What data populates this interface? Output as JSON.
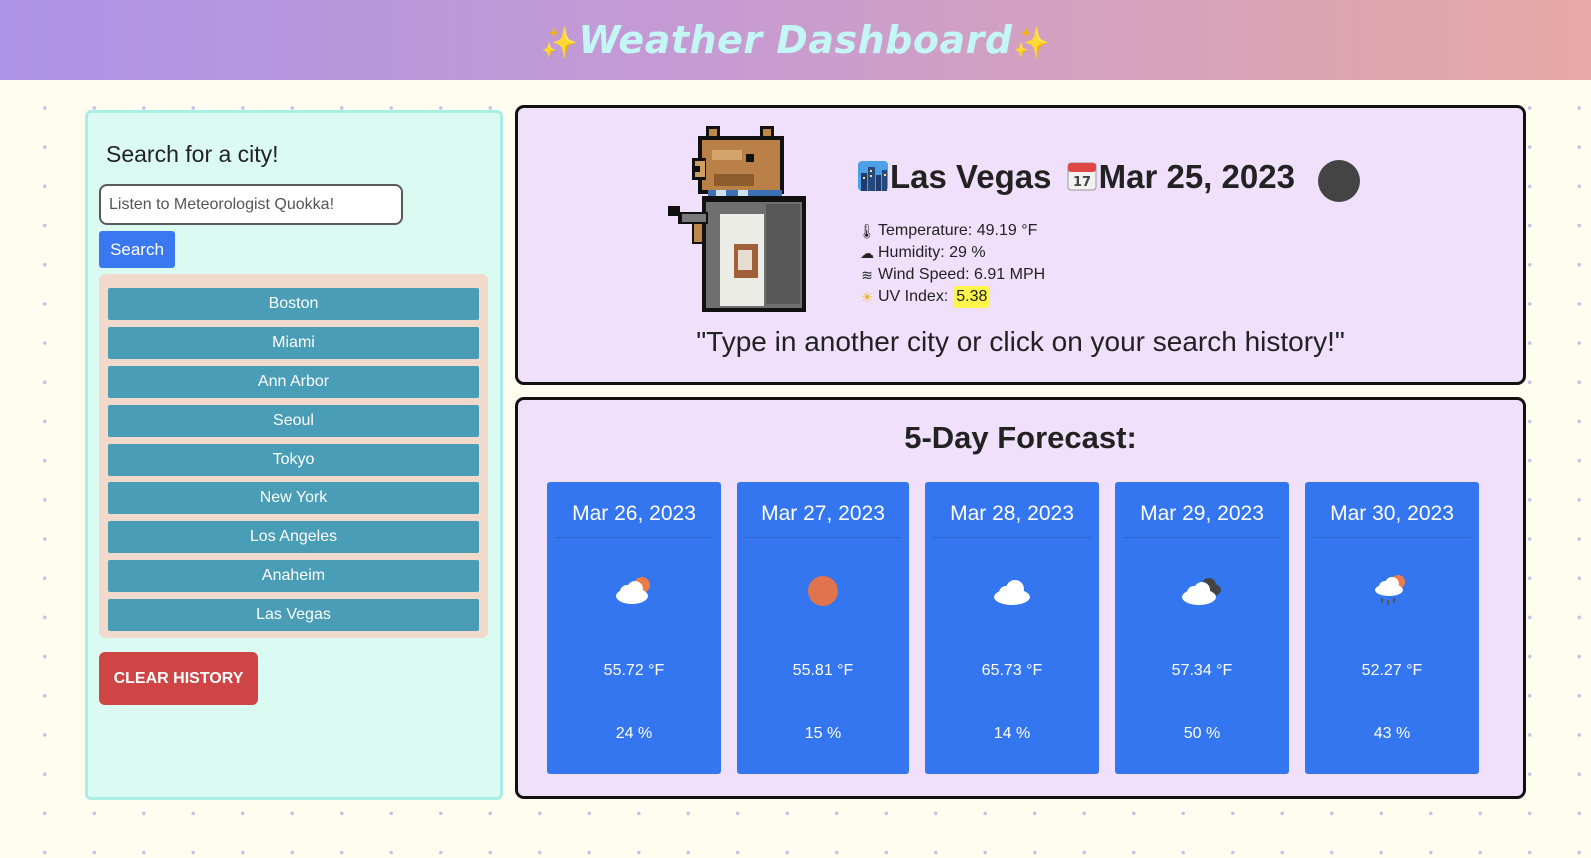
{
  "header": {
    "sparkle_left": "✨",
    "title": "Weather Dashboard",
    "sparkle_right": "✨"
  },
  "search": {
    "heading": "Search for a city!",
    "placeholder": "Listen to Meteorologist Quokka!",
    "button_label": "Search"
  },
  "history": {
    "items": [
      "Boston",
      "Miami",
      "Ann Arbor",
      "Seoul",
      "Tokyo",
      "New York",
      "Los Angeles",
      "Anaheim",
      "Las Vegas"
    ],
    "clear_label": "CLEAR HISTORY"
  },
  "current": {
    "city": "Las Vegas",
    "date": "Mar 25, 2023",
    "city_icon": "cityscape-icon",
    "date_icon": "calendar-icon",
    "status_color": "#444444",
    "temperature_label": "Temperature: 49.19 °F",
    "humidity_label": "Humidity: 29 %",
    "wind_label": "Wind Speed: 6.91 MPH",
    "uv_label": "UV Index:",
    "uv_value": "5.38",
    "quote": "\"Type in another city or click on your search history!\""
  },
  "forecast": {
    "title": "5-Day Forecast:",
    "days": [
      {
        "date": "Mar 26, 2023",
        "icon": "partly-cloudy-icon",
        "temp": "55.72 °F",
        "humidity": "24 %"
      },
      {
        "date": "Mar 27, 2023",
        "icon": "sun-icon",
        "temp": "55.81 °F",
        "humidity": "15 %"
      },
      {
        "date": "Mar 28, 2023",
        "icon": "cloud-icon",
        "temp": "65.73 °F",
        "humidity": "14 %"
      },
      {
        "date": "Mar 29, 2023",
        "icon": "broken-clouds-icon",
        "temp": "57.34 °F",
        "humidity": "50 %"
      },
      {
        "date": "Mar 30, 2023",
        "icon": "rain-sun-icon",
        "temp": "52.27 °F",
        "humidity": "43 %"
      }
    ]
  },
  "colors": {
    "header_start": "#ad93e6",
    "header_end": "#e7a9a5",
    "card_blue": "#3475f0",
    "history_btn": "#4a9db6",
    "clear_btn": "#cf4445"
  }
}
